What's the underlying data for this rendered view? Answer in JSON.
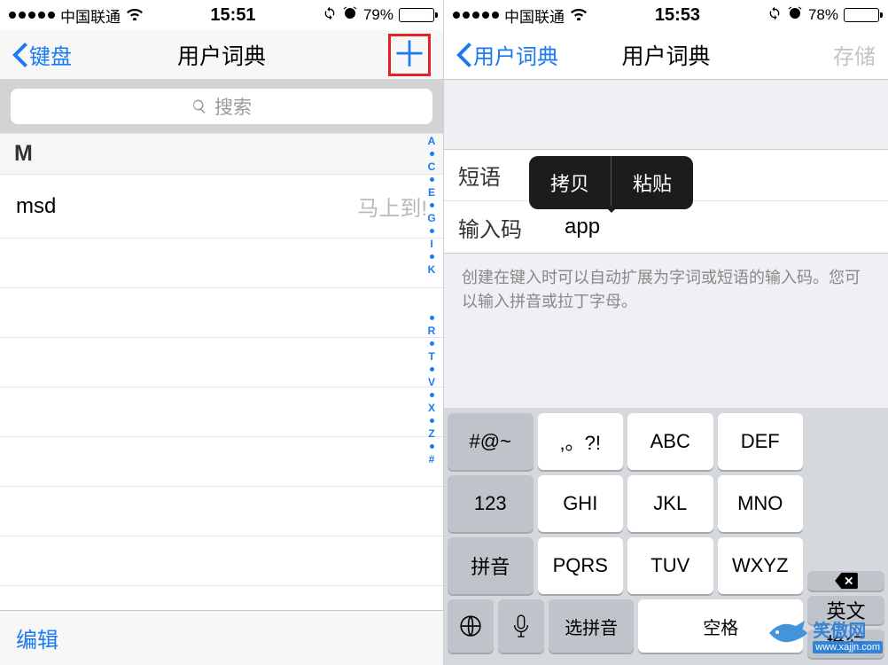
{
  "left": {
    "status": {
      "carrier": "中国联通",
      "time": "15:51",
      "battery_pct": "79%",
      "battery_fill": 79
    },
    "nav": {
      "back": "键盘",
      "title": "用户词典"
    },
    "search": {
      "placeholder": "搜索"
    },
    "section_letter": "M",
    "entry": {
      "code": "msd",
      "phrase": "马上到!"
    },
    "index_letters": [
      "A",
      "C",
      "E",
      "G",
      "I",
      "K",
      "R",
      "T",
      "V",
      "X",
      "Z",
      "#"
    ],
    "toolbar": {
      "edit": "编辑"
    }
  },
  "right": {
    "status": {
      "carrier": "中国联通",
      "time": "15:53",
      "battery_pct": "78%",
      "battery_fill": 78
    },
    "nav": {
      "back": "用户词典",
      "title": "用户词典",
      "save": "存储"
    },
    "tooltip": {
      "copy": "拷贝",
      "paste": "粘贴"
    },
    "form": {
      "phrase_label": "短语",
      "phrase_value": "",
      "code_label": "输入码",
      "code_value": "app"
    },
    "helper": "创建在键入时可以自动扩展为字词或短语的输入码。您可以输入拼音或拉丁字母。",
    "keyboard": {
      "row1": [
        "#@~",
        ",。?!",
        "ABC",
        "DEF"
      ],
      "row2": [
        "123",
        "GHI",
        "JKL",
        "MNO"
      ],
      "row3": [
        "拼音",
        "PQRS",
        "TUV",
        "WXYZ"
      ],
      "bottom": {
        "select": "选拼音",
        "space": "空格"
      },
      "side": {
        "english": "英文",
        "return": "换行"
      }
    }
  },
  "watermark": {
    "name": "笑傲网",
    "url": "www.xajjn.com"
  }
}
